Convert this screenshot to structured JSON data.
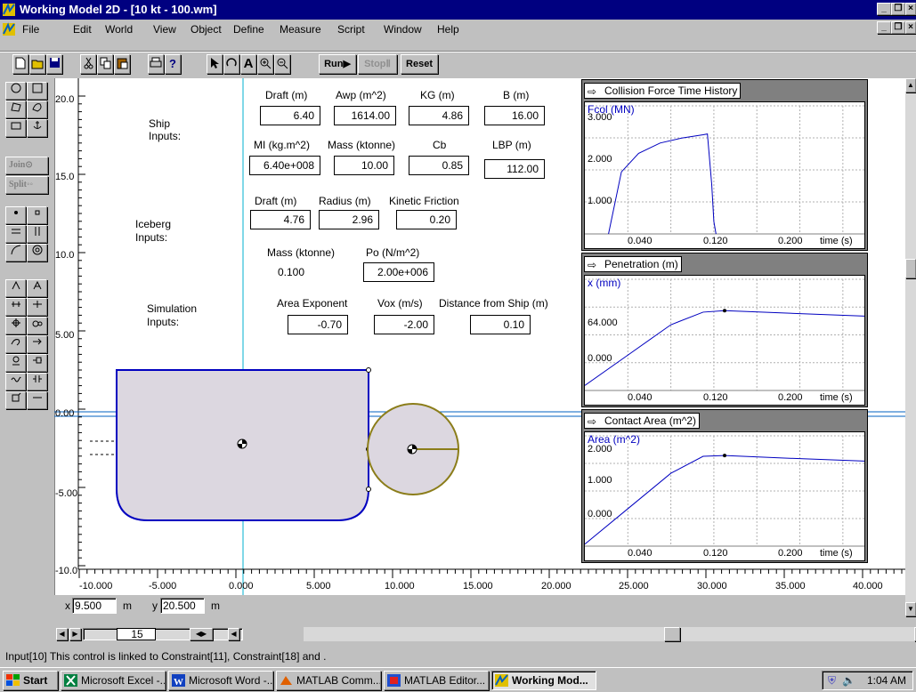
{
  "window": {
    "title": "Working Model 2D - [10 kt - 100.wm]",
    "buttons": [
      "_",
      "×"
    ],
    "maximize_glyph": "❐"
  },
  "menu": {
    "items": [
      "File",
      "Edit",
      "World",
      "View",
      "Object",
      "Define",
      "Measure",
      "Script",
      "Window",
      "Help"
    ]
  },
  "toolbar": {
    "run_label": "Run▶",
    "stop_label": "StopⅡ",
    "reset_label": "Reset"
  },
  "palette": {
    "join_label": "Join⊙",
    "split_label": "Split◦◦"
  },
  "panel": {
    "ship": {
      "section_label_1": "Ship",
      "section_label_2": "Inputs:",
      "draft_label": "Draft (m)",
      "draft_value": "6.40",
      "awp_label": "Awp (m^2)",
      "awp_value": "1614.00",
      "kg_label": "KG (m)",
      "kg_value": "4.86",
      "b_label": "B (m)",
      "b_value": "16.00",
      "mi_label": "MI  (kg.m^2)",
      "mi_value": "6.40e+008",
      "mass_label": "Mass (ktonne)",
      "mass_value": "10.00",
      "cb_label": "Cb",
      "cb_value": "0.85",
      "lbp_label": "LBP (m)",
      "lbp_value": "112.00"
    },
    "iceberg": {
      "section_label_1": "Iceberg",
      "section_label_2": "Inputs:",
      "draft_label": "Draft (m)",
      "draft_value": "4.76",
      "radius_label": "Radius (m)",
      "radius_value": "2.96",
      "friction_label": "Kinetic Friction",
      "friction_value": "0.20",
      "mass_label": "Mass (ktonne)",
      "mass_value": "0.100",
      "po_label": "Po (N/m^2)",
      "po_value": "2.00e+006"
    },
    "simulation": {
      "section_label_1": "Simulation",
      "section_label_2": "Inputs:",
      "exponent_label": "Area Exponent",
      "exponent_value": "-0.70",
      "vox_label": "Vox (m/s)",
      "vox_value": "-2.00",
      "distance_label": "Distance from Ship (m)",
      "distance_value": "0.10"
    }
  },
  "axes": {
    "y_ticks": [
      "20.0",
      "15.0",
      "10.0",
      "5.00",
      "0.00",
      "-5.00",
      "-10.0"
    ],
    "x_ticks": [
      "-10.000",
      "-5.000",
      "0.000",
      "5.000",
      "10.000",
      "15.000",
      "20.000",
      "25.000",
      "30.000",
      "35.000",
      "40.000"
    ]
  },
  "graphs": [
    {
      "title": "Collision Force Time History",
      "ylabel": "Fcol (MN)",
      "y_ticks": [
        "3.000",
        "2.000",
        "1.000"
      ],
      "x_ticks": [
        "0.040",
        "0.120",
        "0.200"
      ],
      "xlabel": "time (s)"
    },
    {
      "title": "Penetration (m)",
      "ylabel": "x (mm)",
      "y_ticks": [
        "64.000",
        "0.000"
      ],
      "x_ticks": [
        "0.040",
        "0.120",
        "0.200"
      ],
      "xlabel": "time (s)"
    },
    {
      "title": "Contact Area (m^2)",
      "ylabel": "Area (m^2)",
      "y_ticks": [
        "2.000",
        "1.000",
        "0.000"
      ],
      "x_ticks": [
        "0.040",
        "0.120",
        "0.200"
      ],
      "xlabel": "time (s)"
    }
  ],
  "chart_data": [
    {
      "type": "line",
      "title": "Collision Force Time History",
      "ylabel": "Fcol (MN)",
      "xlabel": "time (s)",
      "series": [
        {
          "x": [
            0.022,
            0.034,
            0.05,
            0.07,
            0.09,
            0.11,
            0.114,
            0.118,
            0.12,
            0.122
          ],
          "y": [
            0.0,
            1.5,
            1.95,
            2.2,
            2.32,
            2.4,
            2.42,
            1.2,
            0.3,
            0.0
          ]
        }
      ]
    },
    {
      "type": "line",
      "title": "Penetration (m)",
      "ylabel": "x (mm)",
      "xlabel": "time (s)",
      "series": [
        {
          "x": [
            0.0,
            0.04,
            0.08,
            0.11,
            0.13,
            0.2,
            0.3
          ],
          "y": [
            -60,
            0,
            60,
            85,
            88,
            82,
            74
          ]
        }
      ]
    },
    {
      "type": "line",
      "title": "Contact Area (m^2)",
      "ylabel": "Area (m^2)",
      "xlabel": "time (s)",
      "series": [
        {
          "x": [
            0.0,
            0.04,
            0.08,
            0.11,
            0.13,
            0.2,
            0.3
          ],
          "y": [
            -0.35,
            0.55,
            1.45,
            1.88,
            1.9,
            1.82,
            1.72
          ]
        }
      ]
    }
  ],
  "coords": {
    "x_label": "x",
    "x_value": "9.500",
    "x_unit": "m",
    "y_label": "y",
    "y_value": "20.500",
    "y_unit": "m"
  },
  "frame": {
    "value": "15"
  },
  "status": {
    "text": "Input[10]  This control is linked to Constraint[11], Constraint[18] and ."
  },
  "taskbar": {
    "start": "Start",
    "tasks": [
      "Microsoft Excel -...",
      "Microsoft Word -...",
      "MATLAB Comm...",
      "MATLAB Editor...",
      "Working Mod..."
    ],
    "clock": "1:04 AM"
  },
  "colors": {
    "titlebar": "#000080",
    "ship_fill": "#dcd7e0",
    "ship_edge": "#0000c0",
    "iceberg_fill": "#dcd7e0",
    "iceberg_edge": "#8b7d1a",
    "axis_line": "#00b0d0",
    "plot_line": "#0000c0"
  }
}
